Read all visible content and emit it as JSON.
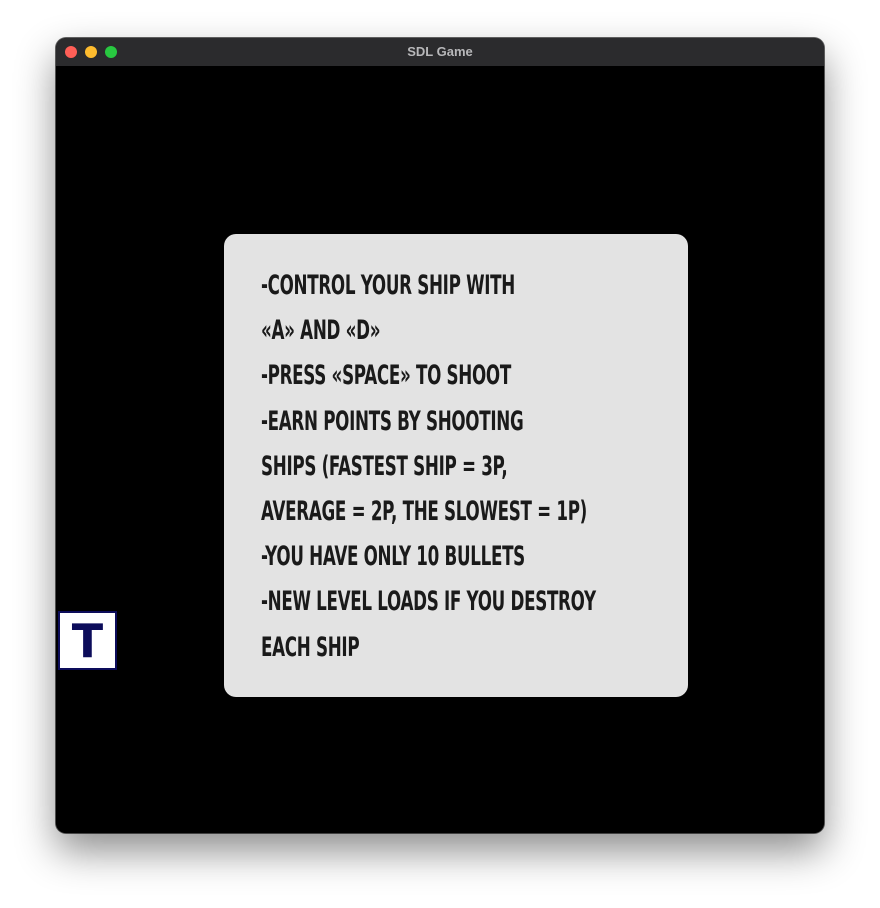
{
  "window": {
    "title": "SDL Game"
  },
  "instructions": {
    "lines": [
      "-CONTROL YOUR SHIP WITH",
      "«A» AND «D»",
      "-PRESS «SPACE» TO SHOOT",
      "-EARN POINTS BY SHOOTING",
      "SHIPS (FASTEST SHIP = 3P,",
      "AVERAGE = 2P, THE SLOWEST = 1P)",
      "-YOU HAVE ONLY 10 BULLETS",
      "-NEW LEVEL LOADS IF YOU DESTROY",
      "EACH SHIP"
    ]
  },
  "tile": {
    "letter": "T"
  },
  "colors": {
    "background": "#000000",
    "panel": "#e3e3e3",
    "panel_text": "#1a1a1a",
    "tile_fill": "#ffffff",
    "tile_accent": "#0c0c5a"
  }
}
